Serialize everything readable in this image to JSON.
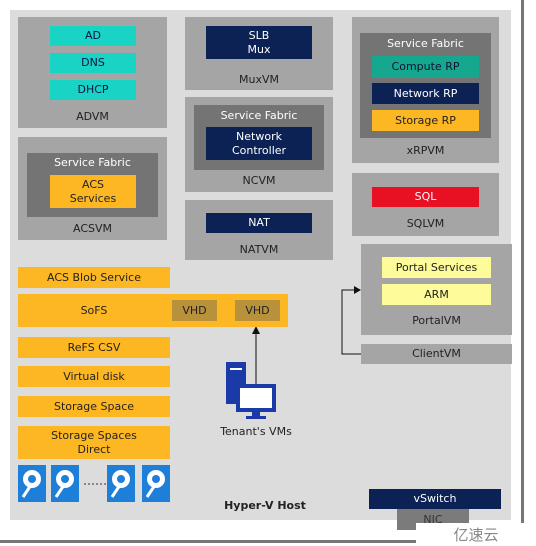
{
  "host": {
    "label": "Hyper-V Host"
  },
  "advm": {
    "label": "ADVM",
    "items": [
      "AD",
      "DNS",
      "DHCP"
    ]
  },
  "acsvm": {
    "label": "ACSVM",
    "fabric": "Service Fabric",
    "service": "ACS Services"
  },
  "muxvm": {
    "label": "MuxVM",
    "service": "SLB Mux"
  },
  "ncvm": {
    "label": "NCVM",
    "fabric": "Service Fabric",
    "service": "Network Controller"
  },
  "natvm": {
    "label": "NATVM",
    "service": "NAT"
  },
  "xrpvm": {
    "label": "xRPVM",
    "fabric": "Service Fabric",
    "items": [
      "Compute RP",
      "Network RP",
      "Storage RP"
    ]
  },
  "sqlvm": {
    "label": "SQLVM",
    "service": "SQL"
  },
  "portalvm": {
    "label": "PortalVM",
    "items": [
      "Portal Services",
      "ARM"
    ]
  },
  "clientvm": {
    "label": "ClientVM"
  },
  "storage": {
    "blob": "ACS Blob Service",
    "sofs": "SoFS",
    "vhd": [
      "VHD",
      "VHD"
    ],
    "refs": "ReFS CSV",
    "vdisk": "Virtual disk",
    "space": "Storage Space",
    "s2d": "Storage Spaces Direct"
  },
  "tenant": {
    "label": "Tenant's VMs"
  },
  "network": {
    "vswitch": "vSwitch",
    "nic": "NIC"
  },
  "watermark": "亿速云",
  "colors": {
    "host": "#dcdcdc",
    "vm": "#a5a5a5",
    "fabric": "#747474",
    "cyan": "#19d3c5",
    "navy": "#0c2154",
    "yellow": "#fcb723",
    "green": "#16a88f",
    "red": "#e81123",
    "lightyellow": "#fefb9b"
  }
}
